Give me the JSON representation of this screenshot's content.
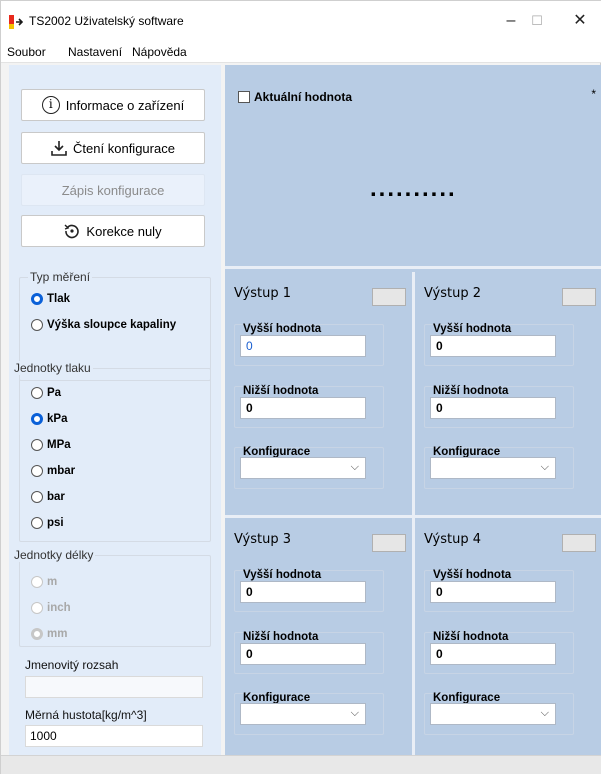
{
  "window": {
    "title": "TS2002 Uživatelský software",
    "minimize": "–",
    "maximize": "☐",
    "close": "✕"
  },
  "menu": [
    "Soubor",
    "Nastavení",
    "Nápověda"
  ],
  "buttons": {
    "info": "Informace o zařízení",
    "read_config": "Čtení konfigurace",
    "write_config": "Zápis konfigurace",
    "zero_correction": "Korekce nuly"
  },
  "measurement_type": {
    "label": "Typ měření",
    "options": [
      {
        "label": "Tlak",
        "selected": true
      },
      {
        "label": "Výška sloupce kapaliny",
        "selected": false
      }
    ]
  },
  "pressure_units": {
    "label": "Jednotky tlaku",
    "options": [
      {
        "label": "Pa",
        "selected": false
      },
      {
        "label": "kPa",
        "selected": true
      },
      {
        "label": "MPa",
        "selected": false
      },
      {
        "label": "mbar",
        "selected": false
      },
      {
        "label": "bar",
        "selected": false
      },
      {
        "label": "psi",
        "selected": false
      }
    ]
  },
  "length_units": {
    "label": "Jednotky délky",
    "options": [
      {
        "label": "m",
        "selected": false
      },
      {
        "label": "inch",
        "selected": false
      },
      {
        "label": "mm",
        "selected": true
      }
    ]
  },
  "nominal_range": {
    "label": "Jmenovitý rozsah",
    "value": ""
  },
  "density": {
    "label": "Měrná hustota[kg/m^3]",
    "value": "1000"
  },
  "current_value": {
    "label": "Aktuální hodnota",
    "star": "*",
    "display": ".........."
  },
  "outputs": [
    {
      "title": "Výstup 1",
      "upper_label": "Vyšší hodnota",
      "upper": "0",
      "lower_label": "Nižší hodnota",
      "lower": "0",
      "config_label": "Konfigurace",
      "config": ""
    },
    {
      "title": "Výstup 2",
      "upper_label": "Vyšší hodnota",
      "upper": "0",
      "lower_label": "Nižší hodnota",
      "lower": "0",
      "config_label": "Konfigurace",
      "config": ""
    },
    {
      "title": "Výstup 3",
      "upper_label": "Vyšší hodnota",
      "upper": "0",
      "lower_label": "Nižší hodnota",
      "lower": "0",
      "config_label": "Konfigurace",
      "config": ""
    },
    {
      "title": "Výstup 4",
      "upper_label": "Vyšší hodnota",
      "upper": "0",
      "lower_label": "Nižší hodnota",
      "lower": "0",
      "config_label": "Konfigurace",
      "config": ""
    }
  ],
  "colors": {
    "accent": "#0a60d8",
    "panel_left": "#e2ecf9",
    "panel_right": "#b8cce4"
  }
}
